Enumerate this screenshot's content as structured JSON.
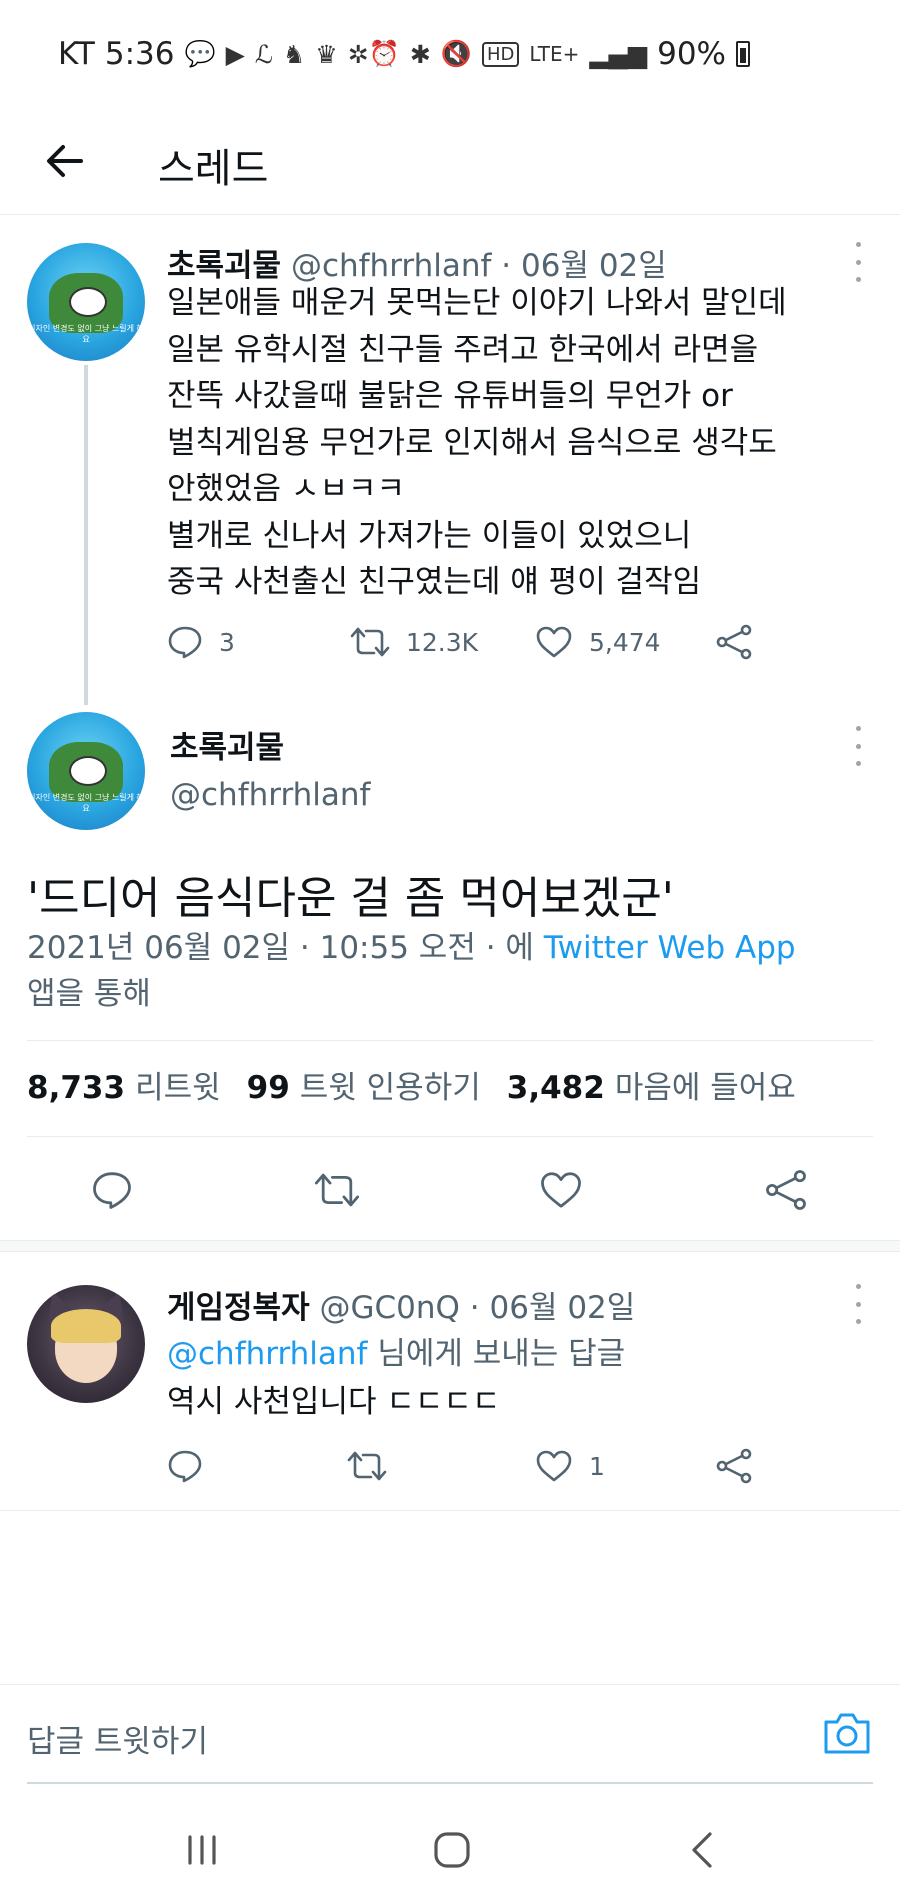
{
  "status_bar": {
    "carrier": "KT",
    "time": "5:36",
    "network": "LTE+",
    "battery": "90%",
    "left_icons": [
      "talk-icon",
      "youtube-icon",
      "lineage-icon",
      "bird-icon",
      "crown-icon",
      "settings-cluster-icon"
    ],
    "right_icons": [
      "alarm-icon",
      "bluetooth-icon",
      "mute-icon",
      "hd-icon",
      "signal-icon",
      "battery-icon"
    ]
  },
  "header": {
    "title": "스레드",
    "back_icon": "arrow-left-icon"
  },
  "tweets": [
    {
      "name": "초록괴물",
      "handle": "@chfhrrhlanf",
      "date_sep": "·",
      "date": "06월 02일",
      "avatar_caption": "디자인 변경도 없이 그냥 느릴게 해요",
      "lines": [
        "일본애들 매운거 못먹는단 이야기 나와서 말인데",
        "일본 유학시절 친구들 주려고 한국에서 라면을",
        "잔뜩 사갔을때 불닭은 유튜버들의 무언가 or",
        "벌칙게임용 무언가로 인지해서 음식으로 생각도",
        "안했었음 ㅅㅂㅋㅋ",
        "별개로 신나서 가져가는 이들이 있었으니",
        "중국 사천출신 친구였는데 얘 평이 걸작임"
      ],
      "replies": "3",
      "retweets": "12.3K",
      "likes": "5,474"
    }
  ],
  "main_tweet": {
    "name": "초록괴물",
    "handle": "@chfhrrhlanf",
    "text": "'드디어 음식다운 걸 좀 먹어보겠군'",
    "meta_prefix": "2021년 06월 02일 · 10:55 오전 · 에 ",
    "meta_app": "Twitter Web App",
    "meta_suffix": "앱을 통해",
    "stats": {
      "retweets_count": "8,733",
      "retweets_label": "리트윗",
      "quotes_count": "99",
      "quotes_label": "트윗 인용하기",
      "likes_count": "3,482",
      "likes_label": "마음에 들어요"
    }
  },
  "reply_tweet": {
    "name": "게임정복자",
    "handle": "@GC0nQ",
    "date_sep": "·",
    "date": "06월 02일",
    "reply_mention": "@chfhrrhlanf",
    "reply_suffix": " 님에게 보내는 답글",
    "text": "역시 사천입니다 ㄷㄷㄷㄷ",
    "replies": "",
    "retweets": "",
    "likes": "1"
  },
  "composer": {
    "placeholder": "답글 트윗하기",
    "camera_icon": "camera-icon"
  },
  "nav": {
    "recents_icon": "recents-icon",
    "home_icon": "home-icon",
    "back_icon": "back-chevron-icon"
  },
  "colors": {
    "accent": "#1d9bf0",
    "text_primary": "#0f1419",
    "text_secondary": "#536471",
    "divider": "#e6ecf0"
  }
}
